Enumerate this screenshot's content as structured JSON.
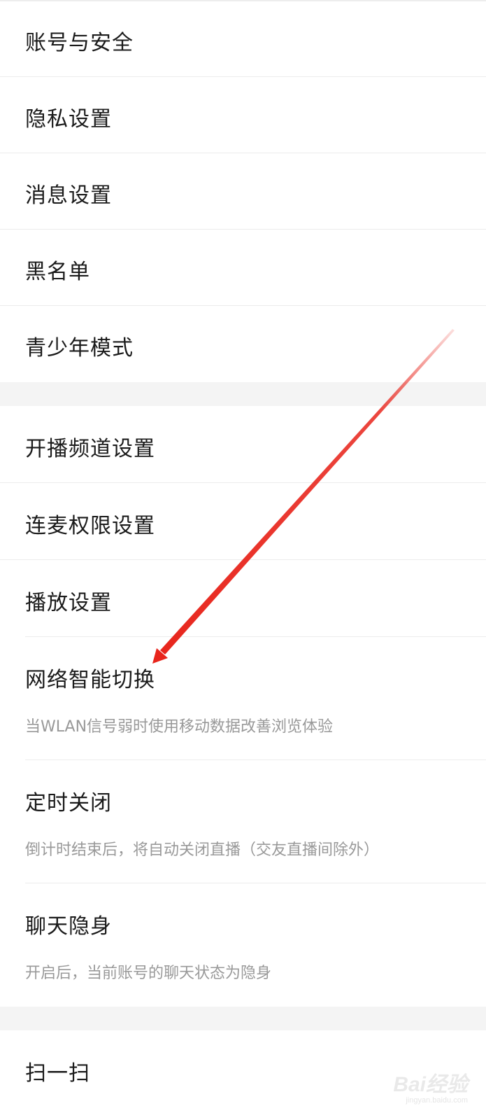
{
  "group1": {
    "items": [
      {
        "label": "账号与安全"
      },
      {
        "label": "隐私设置"
      },
      {
        "label": "消息设置"
      },
      {
        "label": "黑名单"
      },
      {
        "label": "青少年模式"
      }
    ]
  },
  "group2": {
    "items": [
      {
        "label": "开播频道设置"
      },
      {
        "label": "连麦权限设置"
      },
      {
        "label": "播放设置"
      },
      {
        "label": "网络智能切换",
        "desc": "当WLAN信号弱时使用移动数据改善浏览体验"
      },
      {
        "label": "定时关闭",
        "desc": "倒计时结束后，将自动关闭直播（交友直播间除外）"
      },
      {
        "label": "聊天隐身",
        "desc": "开启后，当前账号的聊天状态为隐身"
      }
    ]
  },
  "group3": {
    "items": [
      {
        "label": "扫一扫"
      }
    ]
  },
  "watermark": {
    "brand": "Bai经验",
    "url": "jingyan.baidu.com"
  },
  "colors": {
    "arrow": "#e8251c",
    "section_gap": "#f4f4f4",
    "divider": "#ececec",
    "label": "#1a1a1a",
    "desc": "#999999"
  }
}
